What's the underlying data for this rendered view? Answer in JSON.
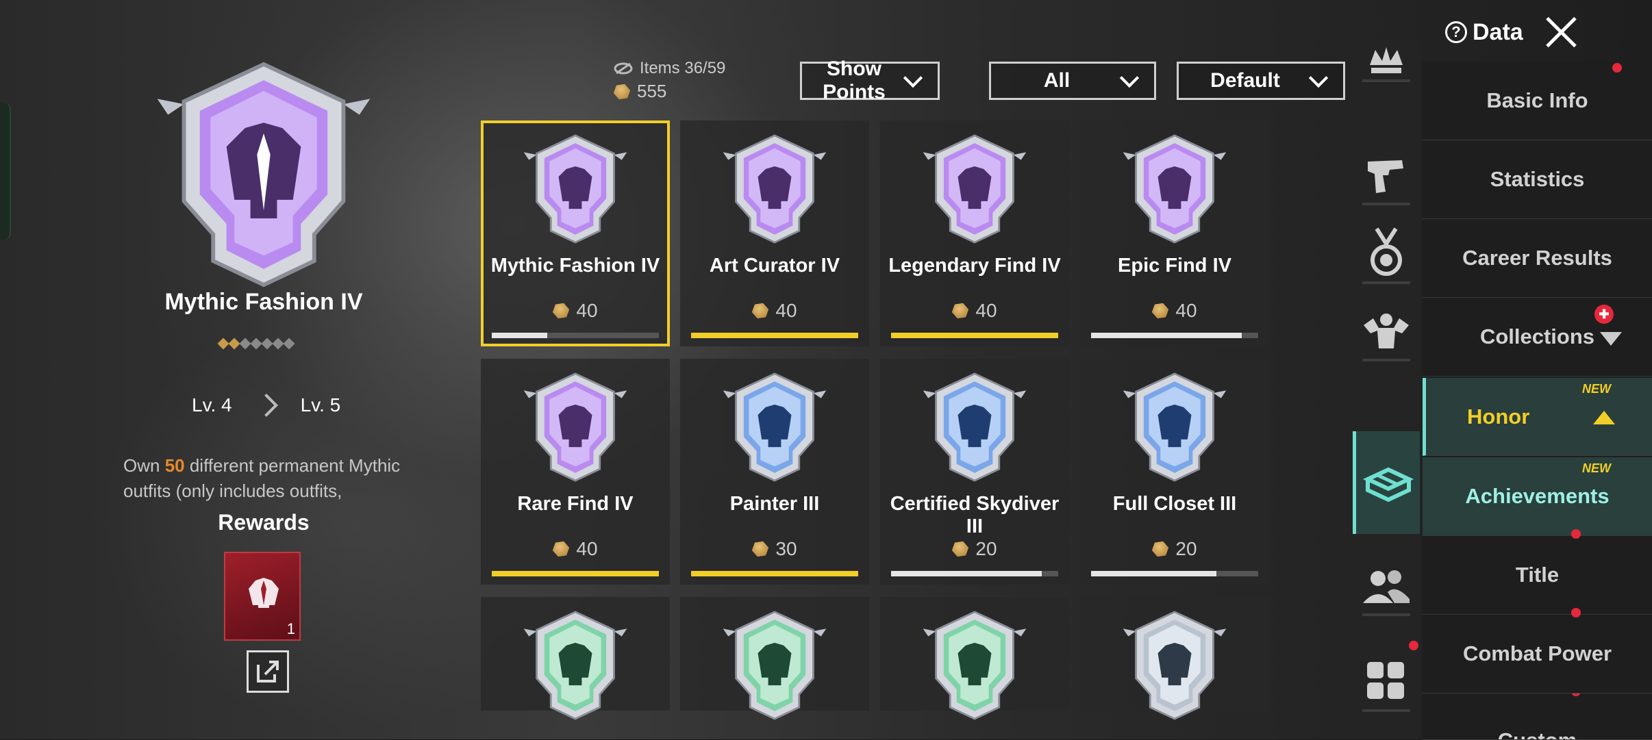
{
  "top": {
    "data_label": "Data"
  },
  "detail": {
    "title": "Mythic Fashion IV",
    "stars_filled": 2,
    "stars_total": 7,
    "level_from": "Lv. 4",
    "level_to": "Lv. 5",
    "desc_pre": "Own ",
    "desc_num": "50",
    "desc_post": " different permanent Mythic outfits (only includes outfits,",
    "rewards_label": "Rewards",
    "reward_count": "1"
  },
  "stats": {
    "items": "Items  36/59",
    "points": "555"
  },
  "filters": [
    "Show Points",
    "All",
    "Default"
  ],
  "colors": {
    "accent": "#f2cf28",
    "teal": "#6fe0cf",
    "mythic": "#a45de6",
    "rare": "#6f9fe6",
    "common": "#66c99a",
    "silver": "#c7cbd4"
  },
  "cards": [
    {
      "name": "Mythic Fashion IV",
      "points": "40",
      "progress": 0.33,
      "tier": "mythic",
      "icon": "jacket-icon"
    },
    {
      "name": "Art Curator IV",
      "points": "40",
      "progress": 1.0,
      "tier": "mythic",
      "icon": "brush-strokes-icon"
    },
    {
      "name": "Legendary Find IV",
      "points": "40",
      "progress": 1.0,
      "tier": "mythic",
      "icon": "jacket-icon"
    },
    {
      "name": "Epic Find IV",
      "points": "40",
      "progress": 0.9,
      "tier": "mythic",
      "icon": "jacket-icon"
    },
    {
      "name": "Rare Find IV",
      "points": "40",
      "progress": 1.0,
      "tier": "mythic",
      "icon": "jacket-icon"
    },
    {
      "name": "Painter III",
      "points": "30",
      "progress": 1.0,
      "tier": "rare",
      "icon": "rifle-crosshair-icon"
    },
    {
      "name": "Certified Skydiver III",
      "points": "20",
      "progress": 0.9,
      "tier": "rare",
      "icon": "parachute-icon"
    },
    {
      "name": "Full Closet III",
      "points": "20",
      "progress": 0.75,
      "tier": "rare",
      "icon": "wardrobe-icon"
    },
    {
      "name": "",
      "points": "",
      "progress": null,
      "tier": "common",
      "icon": "dancer-icon"
    },
    {
      "name": "",
      "points": "",
      "progress": null,
      "tier": "common",
      "icon": "dancer-icon"
    },
    {
      "name": "",
      "points": "",
      "progress": null,
      "tier": "common",
      "icon": "dancer-icon"
    },
    {
      "name": "",
      "points": "",
      "progress": null,
      "tier": "silver",
      "icon": "eagle-icon"
    }
  ],
  "menu": {
    "basic_info": "Basic Info",
    "statistics": "Statistics",
    "career_results": "Career Results",
    "collections": "Collections",
    "honor": "Honor",
    "achievements": "Achievements",
    "title": "Title",
    "combat_power": "Combat Power",
    "custom": "Custom",
    "new_tag": "NEW"
  }
}
